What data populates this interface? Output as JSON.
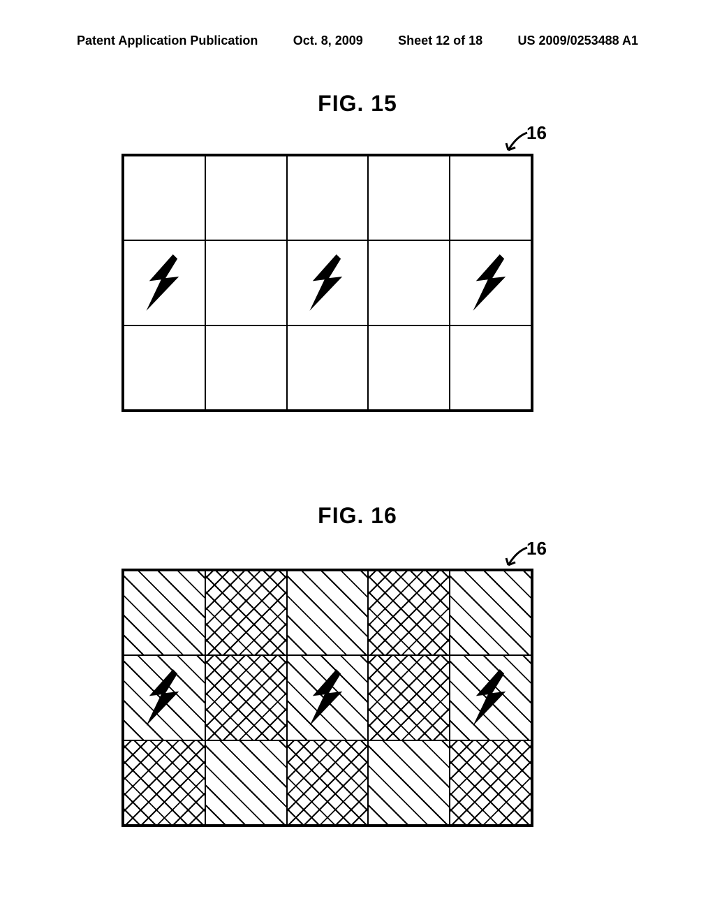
{
  "header": {
    "publication_type": "Patent Application Publication",
    "date": "Oct. 8, 2009",
    "sheet_info": "Sheet 12 of 18",
    "patent_number": "US 2009/0253488 A1"
  },
  "figures": {
    "fig15": {
      "title": "FIG. 15",
      "reference": "16",
      "grid": {
        "rows": 3,
        "cols": 5,
        "cells": [
          {
            "row": 0,
            "col": 0,
            "pattern": "none",
            "symbol": "none"
          },
          {
            "row": 0,
            "col": 1,
            "pattern": "none",
            "symbol": "none"
          },
          {
            "row": 0,
            "col": 2,
            "pattern": "none",
            "symbol": "none"
          },
          {
            "row": 0,
            "col": 3,
            "pattern": "none",
            "symbol": "none"
          },
          {
            "row": 0,
            "col": 4,
            "pattern": "none",
            "symbol": "none"
          },
          {
            "row": 1,
            "col": 0,
            "pattern": "none",
            "symbol": "bolt"
          },
          {
            "row": 1,
            "col": 1,
            "pattern": "none",
            "symbol": "none"
          },
          {
            "row": 1,
            "col": 2,
            "pattern": "none",
            "symbol": "bolt"
          },
          {
            "row": 1,
            "col": 3,
            "pattern": "none",
            "symbol": "none"
          },
          {
            "row": 1,
            "col": 4,
            "pattern": "none",
            "symbol": "bolt"
          },
          {
            "row": 2,
            "col": 0,
            "pattern": "none",
            "symbol": "none"
          },
          {
            "row": 2,
            "col": 1,
            "pattern": "none",
            "symbol": "none"
          },
          {
            "row": 2,
            "col": 2,
            "pattern": "none",
            "symbol": "none"
          },
          {
            "row": 2,
            "col": 3,
            "pattern": "none",
            "symbol": "none"
          },
          {
            "row": 2,
            "col": 4,
            "pattern": "none",
            "symbol": "none"
          }
        ]
      }
    },
    "fig16": {
      "title": "FIG. 16",
      "reference": "16",
      "grid": {
        "rows": 3,
        "cols": 5,
        "cells": [
          {
            "row": 0,
            "col": 0,
            "pattern": "diag",
            "symbol": "none"
          },
          {
            "row": 0,
            "col": 1,
            "pattern": "cross",
            "symbol": "none"
          },
          {
            "row": 0,
            "col": 2,
            "pattern": "diag",
            "symbol": "none"
          },
          {
            "row": 0,
            "col": 3,
            "pattern": "cross",
            "symbol": "none"
          },
          {
            "row": 0,
            "col": 4,
            "pattern": "diag",
            "symbol": "none"
          },
          {
            "row": 1,
            "col": 0,
            "pattern": "diag",
            "symbol": "bolt"
          },
          {
            "row": 1,
            "col": 1,
            "pattern": "cross",
            "symbol": "none"
          },
          {
            "row": 1,
            "col": 2,
            "pattern": "diag",
            "symbol": "bolt"
          },
          {
            "row": 1,
            "col": 3,
            "pattern": "cross",
            "symbol": "none"
          },
          {
            "row": 1,
            "col": 4,
            "pattern": "diag",
            "symbol": "bolt"
          },
          {
            "row": 2,
            "col": 0,
            "pattern": "cross",
            "symbol": "none"
          },
          {
            "row": 2,
            "col": 1,
            "pattern": "diag",
            "symbol": "none"
          },
          {
            "row": 2,
            "col": 2,
            "pattern": "cross",
            "symbol": "none"
          },
          {
            "row": 2,
            "col": 3,
            "pattern": "diag",
            "symbol": "none"
          },
          {
            "row": 2,
            "col": 4,
            "pattern": "cross",
            "symbol": "none"
          }
        ]
      }
    }
  }
}
